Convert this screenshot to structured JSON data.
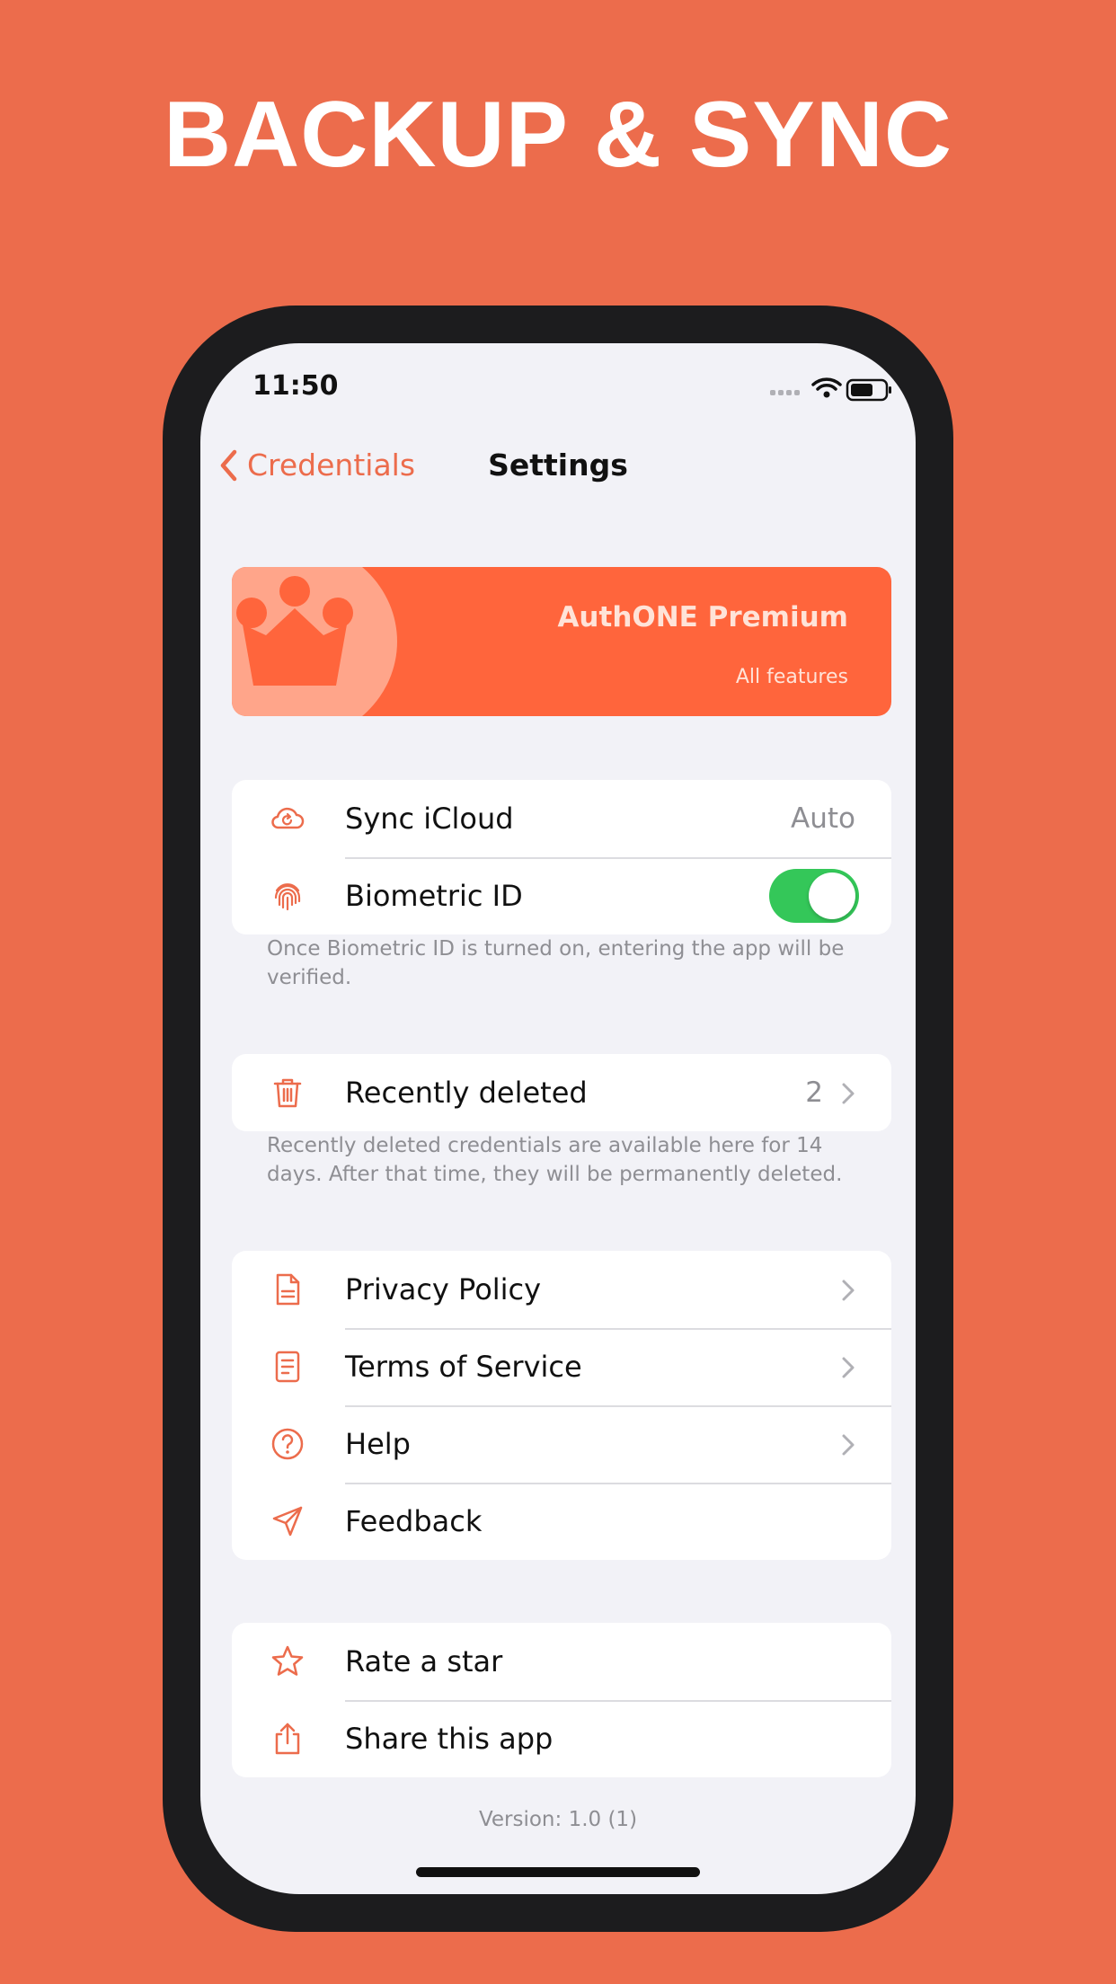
{
  "promo": {
    "headline": "BACKUP & SYNC"
  },
  "status_bar": {
    "time": "11:50"
  },
  "nav": {
    "back_label": "Credentials",
    "title": "Settings"
  },
  "premium": {
    "title": "AuthONE Premium",
    "subtitle": "All features"
  },
  "settings": {
    "sync": {
      "label": "Sync iCloud",
      "value": "Auto"
    },
    "biometric": {
      "label": "Biometric ID",
      "enabled": true
    },
    "biometric_note": "Once Biometric ID is turned on, entering the app will be verified.",
    "recently_deleted": {
      "label": "Recently deleted",
      "count": "2"
    },
    "recently_deleted_note": "Recently deleted credentials are available here for 14 days. After that time, they will be permanently deleted.",
    "privacy": {
      "label": "Privacy Policy"
    },
    "terms": {
      "label": "Terms of Service"
    },
    "help": {
      "label": "Help"
    },
    "feedback": {
      "label": "Feedback"
    },
    "rate": {
      "label": "Rate a star"
    },
    "share": {
      "label": "Share this app"
    }
  },
  "version": "Version: 1.0 (1)",
  "colors": {
    "background": "#EC6C4C",
    "accent": "#EC6C4C",
    "premium_card": "#FF653C",
    "toggle_on": "#34C759"
  },
  "icons": {
    "sync": "cloud-sync-icon",
    "biometric": "fingerprint-icon",
    "recently_deleted": "trash-icon",
    "privacy": "document-icon",
    "terms": "list-document-icon",
    "help": "question-circle-icon",
    "feedback": "send-icon",
    "rate": "star-icon",
    "share": "share-icon",
    "premium": "crown-icon"
  }
}
